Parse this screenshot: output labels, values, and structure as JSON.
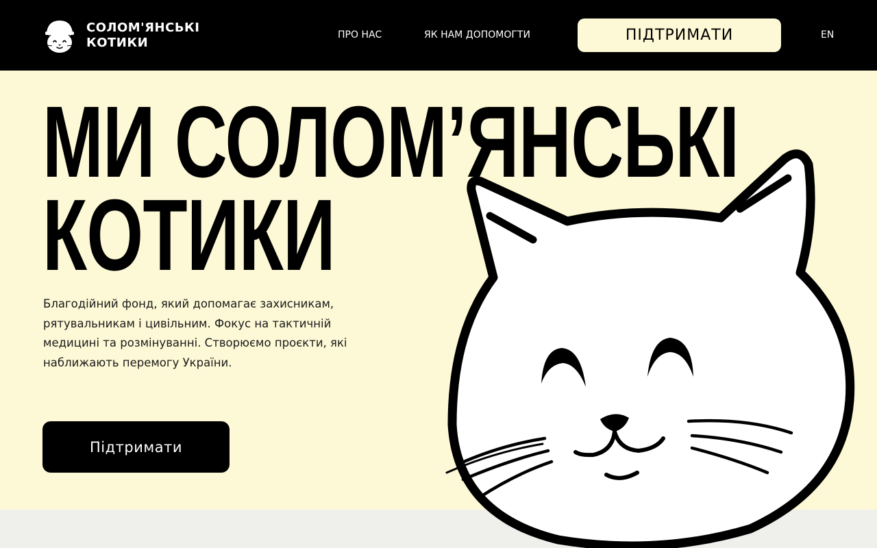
{
  "header": {
    "logo_line1": "СОЛОМ'ЯНСЬКІ",
    "logo_line2": "КОТИКИ",
    "nav": {
      "about": "ПРО НАС",
      "help": "ЯК НАМ ДОПОМОГТИ",
      "support": "ПІДТРИМАТИ",
      "language": "EN"
    }
  },
  "hero": {
    "title_line1": "МИ СОЛОМ’ЯНСЬКІ",
    "title_line2": "КОТИКИ",
    "description": "Благодійний фонд, який допомагає захисникам, рятувальникам і цивільним. Фокус на тактичній медицині та розмінуванні. Створюємо проєкти, які наближають перемогу України.",
    "cta": "Підтримати"
  },
  "icons": {
    "logo": "cat-helmet-logo-icon",
    "illustration": "smiling-cat-illustration"
  },
  "colors": {
    "header_bg": "#000000",
    "page_bg": "#fdf9d6",
    "accent_button_bg": "#fdf9d6",
    "primary_button_bg": "#000000",
    "bottom_band": "#eff0ec"
  }
}
